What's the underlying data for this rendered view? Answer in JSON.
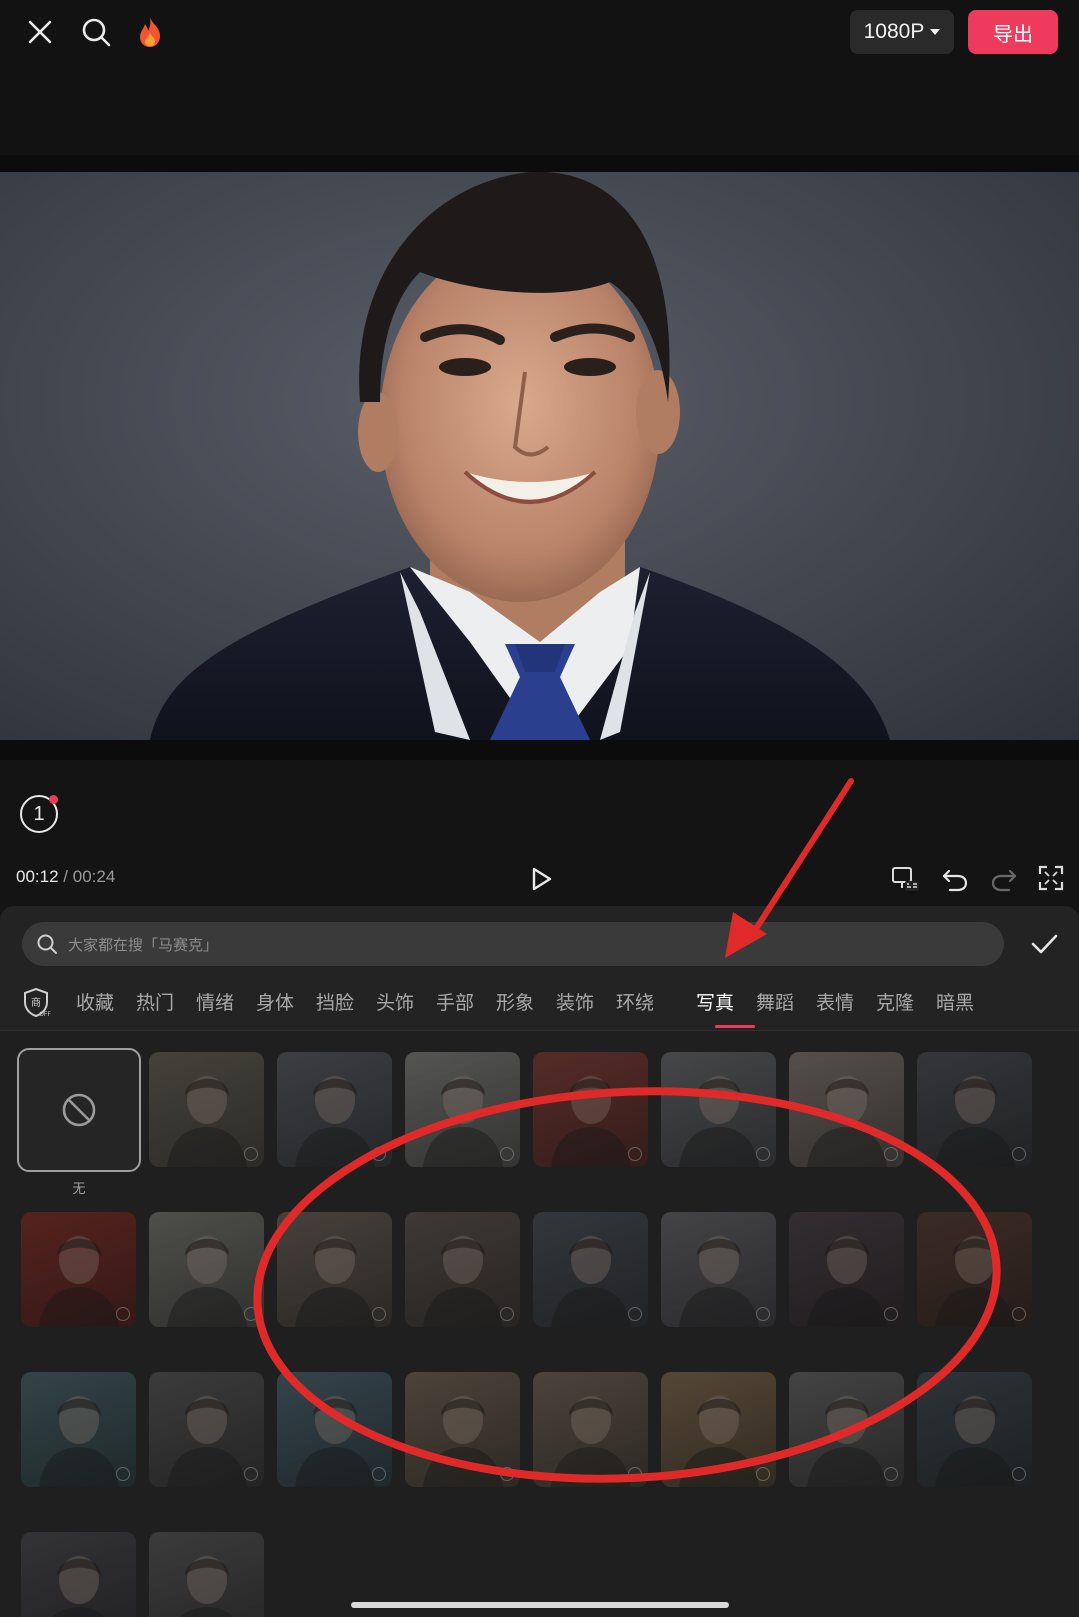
{
  "toolbar": {
    "resolution": "1080P",
    "export_label": "导出"
  },
  "player": {
    "layer_count": "1",
    "current_time": "00:12",
    "separator": "/",
    "total_time": "00:24"
  },
  "effects_panel": {
    "search_placeholder": "大家都在搜「马赛克」",
    "categories": [
      "收藏",
      "热门",
      "情绪",
      "身体",
      "挡脸",
      "头饰",
      "手部",
      "形象",
      "装饰",
      "环绕",
      "写真",
      "舞蹈",
      "表情",
      "克隆",
      "暗黑"
    ],
    "active_category": "写真",
    "none_label": "无"
  },
  "colors": {
    "accent": "#ee3b5b",
    "annotation": "#e02a2a",
    "background": "#141414",
    "panel": "#232323"
  },
  "icons": [
    "close-icon",
    "search-icon",
    "fire-icon",
    "layers-icon",
    "play-icon",
    "commercial-off-icon",
    "undo-icon",
    "redo-icon",
    "fullscreen-icon",
    "check-icon",
    "none-icon"
  ]
}
